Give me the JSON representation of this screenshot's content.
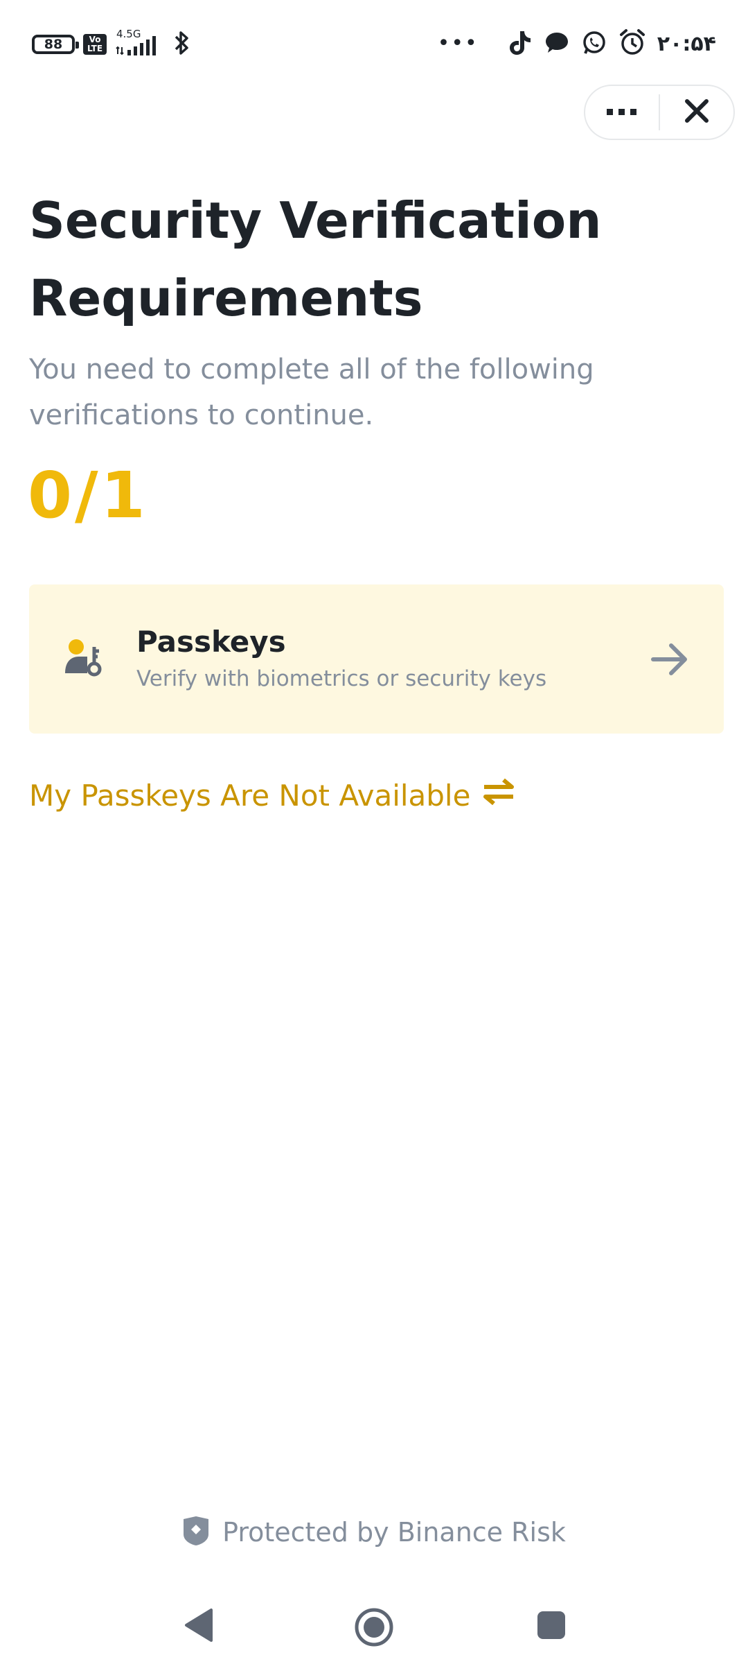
{
  "status_bar": {
    "battery_level": "88",
    "network_label": "4.5G",
    "volte_label": "Vo LTE",
    "more_indicator": "•••",
    "time": "۲۰:۵۴",
    "icons": [
      "battery-icon",
      "volte-icon",
      "signal-icon",
      "bluetooth-icon",
      "tiktok-icon",
      "chat-icon",
      "whatsapp-icon",
      "alarm-icon"
    ]
  },
  "capsule": {
    "more_label": "•••",
    "icons": [
      "more-icon",
      "close-icon"
    ]
  },
  "page": {
    "title": "Security Verification Requirements",
    "subtitle": "You need to complete all of the following verifications to continue.",
    "progress": "0/1"
  },
  "methods": [
    {
      "title": "Passkeys",
      "description": "Verify with biometrics or security keys",
      "icon": "passkey-icon",
      "action_icon": "arrow-right-icon"
    }
  ],
  "alternative_link": {
    "label": "My Passkeys Are Not Available",
    "icon": "switch-arrows-icon"
  },
  "footer": {
    "text": "Protected by Binance Risk",
    "icon": "shield-icon"
  },
  "navigation_bar": {
    "icons": [
      "back-icon",
      "home-icon",
      "recents-icon"
    ]
  },
  "colors": {
    "accent": "#F0B90B",
    "link": "#C99400",
    "card_background": "#FEF8E0",
    "text_primary": "#1E2329",
    "text_secondary": "#848E9C"
  }
}
